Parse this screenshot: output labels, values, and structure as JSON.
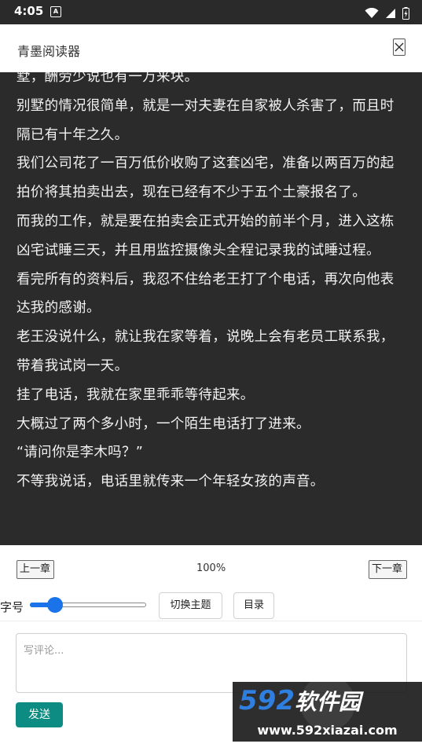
{
  "status_bar": {
    "time": "4:05",
    "notification_letter": "A",
    "icons": [
      "wifi-icon",
      "signal-icon",
      "battery-icon"
    ]
  },
  "header": {
    "title": "青墨阅读器",
    "close_icon": "close-icon"
  },
  "reader": {
    "background": "#2b2b2b",
    "text_color": "#f2f2f2",
    "paragraphs": [
      "墅，酬劳少说也有一万来块。",
      "别墅的情况很简单，就是一对夫妻在自家被人杀害了，而且时隔已有十年之久。",
      "我们公司花了一百万低价收购了这套凶宅，准备以两百万的起拍价将其拍卖出去，现在已经有不少于五个土豪报名了。",
      "而我的工作，就是要在拍卖会正式开始的前半个月，进入这栋凶宅试睡三天，并且用监控摄像头全程记录我的试睡过程。",
      "看完所有的资料后，我忍不住给老王打了个电话，再次向他表达我的感谢。",
      "老王没说什么，就让我在家等着，说晚上会有老员工联系我，带着我试岗一天。",
      "挂了电话，我就在家里乖乖等待起来。",
      "大概过了两个多小时，一个陌生电话打了进来。",
      "“请问你是李木吗？”",
      "不等我说话，电话里就传来一个年轻女孩的声音。"
    ]
  },
  "controls": {
    "prev_label": "上一章",
    "next_label": "下一章",
    "progress": "100%",
    "font_size_label": "字号",
    "font_slider_value": 0.17,
    "theme_label": "切换主题",
    "toc_label": "目录",
    "accent_color": "#1a73e8"
  },
  "comment": {
    "placeholder": "写评论...",
    "send_label": "发送",
    "send_color": "#0c8c82"
  },
  "watermark": {
    "brand_number": "592",
    "brand_name": "软件园",
    "url": "www.592xiazai.com"
  }
}
